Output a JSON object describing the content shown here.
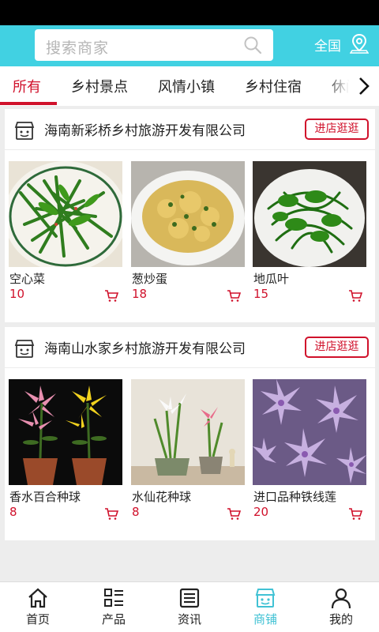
{
  "header": {
    "search_placeholder": "搜索商家",
    "region_label": "全国",
    "bg_color": "#41d1e2"
  },
  "tabs": [
    {
      "label": "所有",
      "active": true
    },
    {
      "label": "乡村景点"
    },
    {
      "label": "风情小镇"
    },
    {
      "label": "乡村住宿"
    },
    {
      "label": "休闲"
    }
  ],
  "shops": [
    {
      "name": "海南新彩桥乡村旅游开发有限公司",
      "visit_label": "进店逛逛",
      "products": [
        {
          "name": "空心菜",
          "price": "10"
        },
        {
          "name": "葱炒蛋",
          "price": "18"
        },
        {
          "name": "地瓜叶",
          "price": "15"
        }
      ]
    },
    {
      "name": "海南山水家乡村旅游开发有限公司",
      "visit_label": "进店逛逛",
      "products": [
        {
          "name": "香水百合种球",
          "price": "8"
        },
        {
          "name": "水仙花种球",
          "price": "8"
        },
        {
          "name": "进口品种铁线莲",
          "price": "20"
        }
      ]
    }
  ],
  "bottom_nav": [
    {
      "label": "首页",
      "icon": "home-icon"
    },
    {
      "label": "产品",
      "icon": "list-icon"
    },
    {
      "label": "资讯",
      "icon": "news-icon"
    },
    {
      "label": "商铺",
      "icon": "shop-icon",
      "active": true
    },
    {
      "label": "我的",
      "icon": "user-icon"
    }
  ],
  "colors": {
    "accent_red": "#d0112b",
    "accent_cyan": "#41c2d4"
  }
}
